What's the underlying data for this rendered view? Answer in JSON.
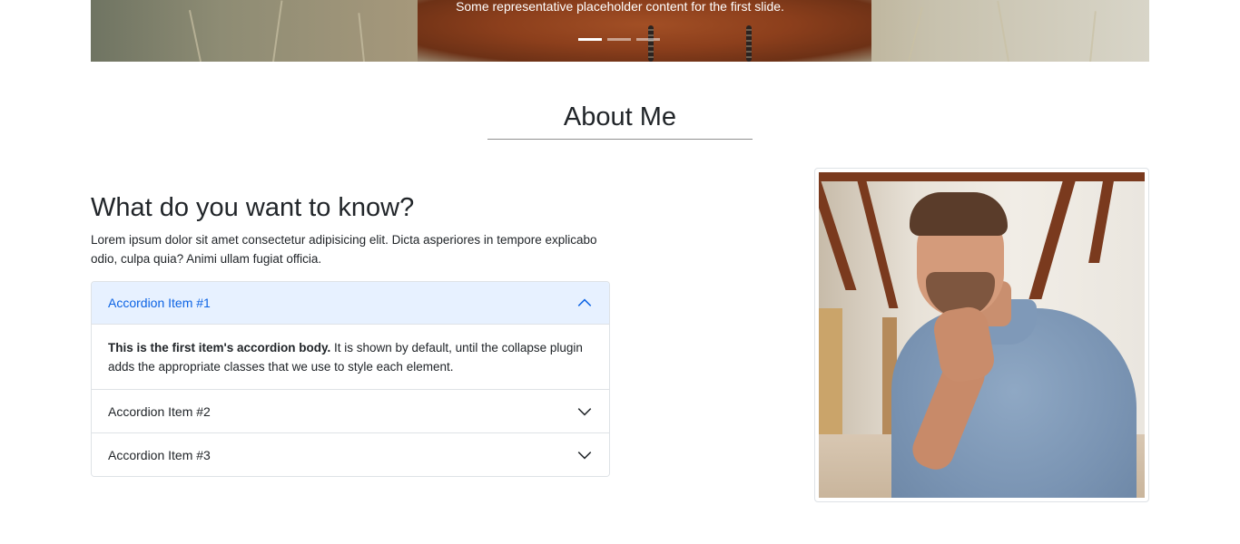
{
  "carousel": {
    "caption": "Some representative placeholder content for the first slide.",
    "indicators": [
      {
        "label": "Slide 1",
        "active": true
      },
      {
        "label": "Slide 2",
        "active": false
      },
      {
        "label": "Slide 3",
        "active": false
      }
    ]
  },
  "about": {
    "section_title": "About Me",
    "heading": "What do you want to know?",
    "intro": "Lorem ipsum dolor sit amet consectetur adipisicing elit. Dicta asperiores in tempore explicabo odio, culpa quia? Animi ullam fugiat officia."
  },
  "accordion": {
    "items": [
      {
        "label": "Accordion Item #1",
        "expanded": true,
        "body_strong": "This is the first item's accordion body.",
        "body_text": " It is shown by default, until the collapse plugin adds the appropriate classes that we use to style each element."
      },
      {
        "label": "Accordion Item #2",
        "expanded": false
      },
      {
        "label": "Accordion Item #3",
        "expanded": false
      }
    ]
  },
  "colors": {
    "accordion_active_bg": "#e7f1ff",
    "accordion_active_text": "#0c63e4",
    "border": "#dee2e6",
    "text": "#212529"
  },
  "icons": {
    "expanded": "chevron-up-icon",
    "collapsed": "chevron-down-icon"
  }
}
